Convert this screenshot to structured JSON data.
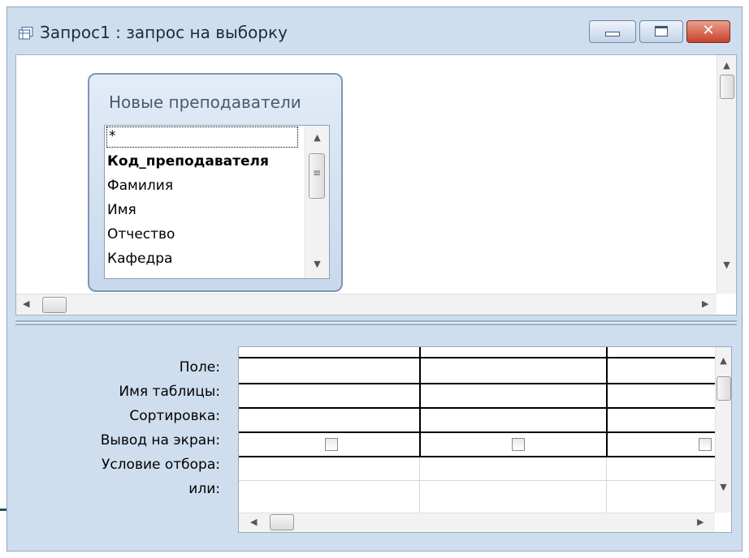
{
  "window": {
    "title": "Запрос1 : запрос на выборку",
    "close_glyph": "✕"
  },
  "table": {
    "title": "Новые преподаватели",
    "fields": [
      "*",
      "Код_преподавателя",
      "Фамилия",
      "Имя",
      "Отчество",
      "Кафедра"
    ]
  },
  "grid": {
    "row_labels": [
      "Поле:",
      "Имя таблицы:",
      "Сортировка:",
      "Вывод на экран:",
      "Условие отбора:",
      "или:"
    ]
  },
  "scroll": {
    "up": "▲",
    "down": "▼",
    "left": "◀",
    "right": "▶",
    "grip": "≡"
  },
  "colors": {
    "frame": "#cfdeee",
    "accent": "#7e96b6",
    "close": "#c8412a"
  }
}
